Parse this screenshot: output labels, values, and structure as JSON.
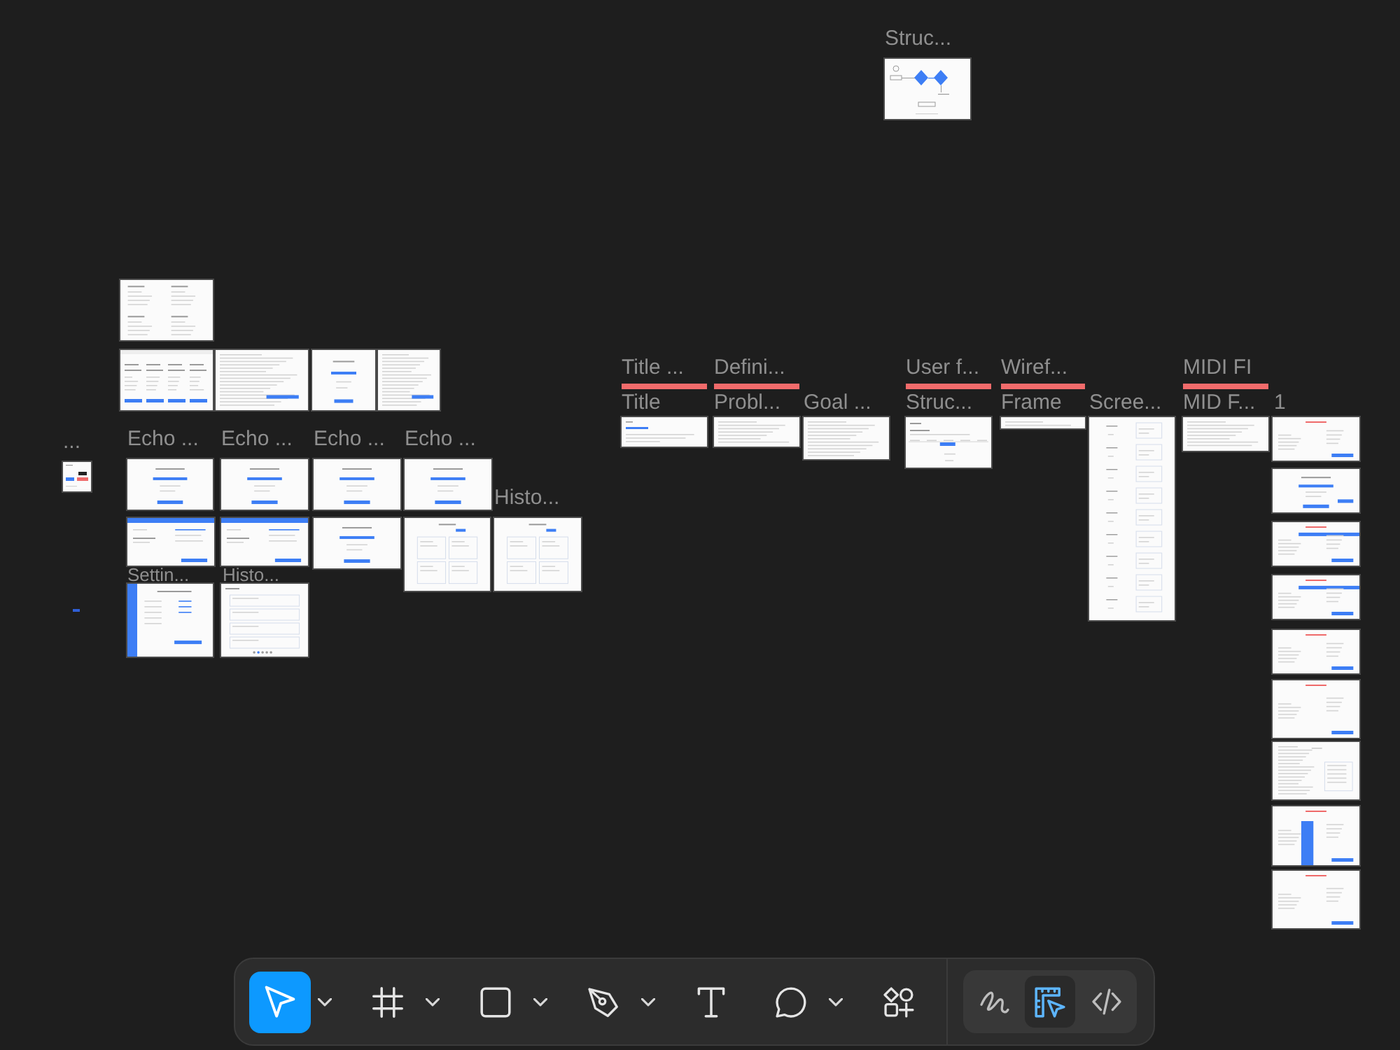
{
  "canvas": {
    "frames": [
      {
        "label": "Struc...",
        "kind": "thumbnail"
      },
      {
        "kind": "thumbnail"
      },
      {
        "kind": "thumbnail"
      },
      {
        "kind": "thumbnail"
      },
      {
        "kind": "thumbnail"
      },
      {
        "kind": "thumbnail"
      },
      {
        "label": "...",
        "kind": "thumbnail"
      },
      {
        "label": "Echo ...",
        "kind": "thumbnail"
      },
      {
        "label": "Echo ...",
        "kind": "thumbnail"
      },
      {
        "label": "Echo ...",
        "kind": "thumbnail"
      },
      {
        "label": "Echo ...",
        "kind": "thumbnail"
      },
      {
        "kind": "thumbnail"
      },
      {
        "kind": "thumbnail"
      },
      {
        "kind": "thumbnail"
      },
      {
        "kind": "thumbnail"
      },
      {
        "label": "Histo...",
        "kind": "thumbnail"
      },
      {
        "label": "Settin...",
        "kind": "thumbnail"
      },
      {
        "label": "Histo...",
        "kind": "thumbnail"
      },
      {
        "kind": "marker"
      },
      {
        "label": "Title ...",
        "kind": "bar"
      },
      {
        "label": "Defini...",
        "kind": "bar"
      },
      {
        "label": "User f...",
        "kind": "bar"
      },
      {
        "label": "Wiref...",
        "kind": "bar"
      },
      {
        "label": "MIDI FI",
        "kind": "bar"
      },
      {
        "label": "Title",
        "kind": "thumbnail"
      },
      {
        "label": "Probl...",
        "kind": "thumbnail"
      },
      {
        "label": "Goal ...",
        "kind": "thumbnail"
      },
      {
        "label": "Struc...",
        "kind": "thumbnail"
      },
      {
        "label": "Frame",
        "kind": "thumbnail"
      },
      {
        "label": "Scree...",
        "kind": "thumbnail"
      },
      {
        "label": "MID F...",
        "kind": "thumbnail"
      },
      {
        "label": "1",
        "kind": "thumbnail"
      },
      {
        "kind": "thumbnail"
      },
      {
        "kind": "thumbnail"
      },
      {
        "kind": "thumbnail"
      },
      {
        "kind": "thumbnail"
      },
      {
        "kind": "thumbnail"
      },
      {
        "kind": "thumbnail"
      },
      {
        "kind": "thumbnail"
      },
      {
        "kind": "thumbnail"
      }
    ]
  },
  "toolbar": {
    "tools": [
      {
        "kind": "move",
        "selected": true,
        "menu": true
      },
      {
        "kind": "frame",
        "selected": false,
        "menu": true
      },
      {
        "kind": "shape",
        "selected": false,
        "menu": true
      },
      {
        "kind": "pen",
        "selected": false,
        "menu": true
      },
      {
        "kind": "text",
        "selected": false,
        "menu": false
      },
      {
        "kind": "comment",
        "selected": false,
        "menu": true
      },
      {
        "kind": "actions",
        "selected": false,
        "menu": false
      }
    ],
    "modes": [
      {
        "kind": "draw",
        "selected": false
      },
      {
        "kind": "design",
        "selected": true
      },
      {
        "kind": "dev",
        "selected": false
      }
    ]
  }
}
